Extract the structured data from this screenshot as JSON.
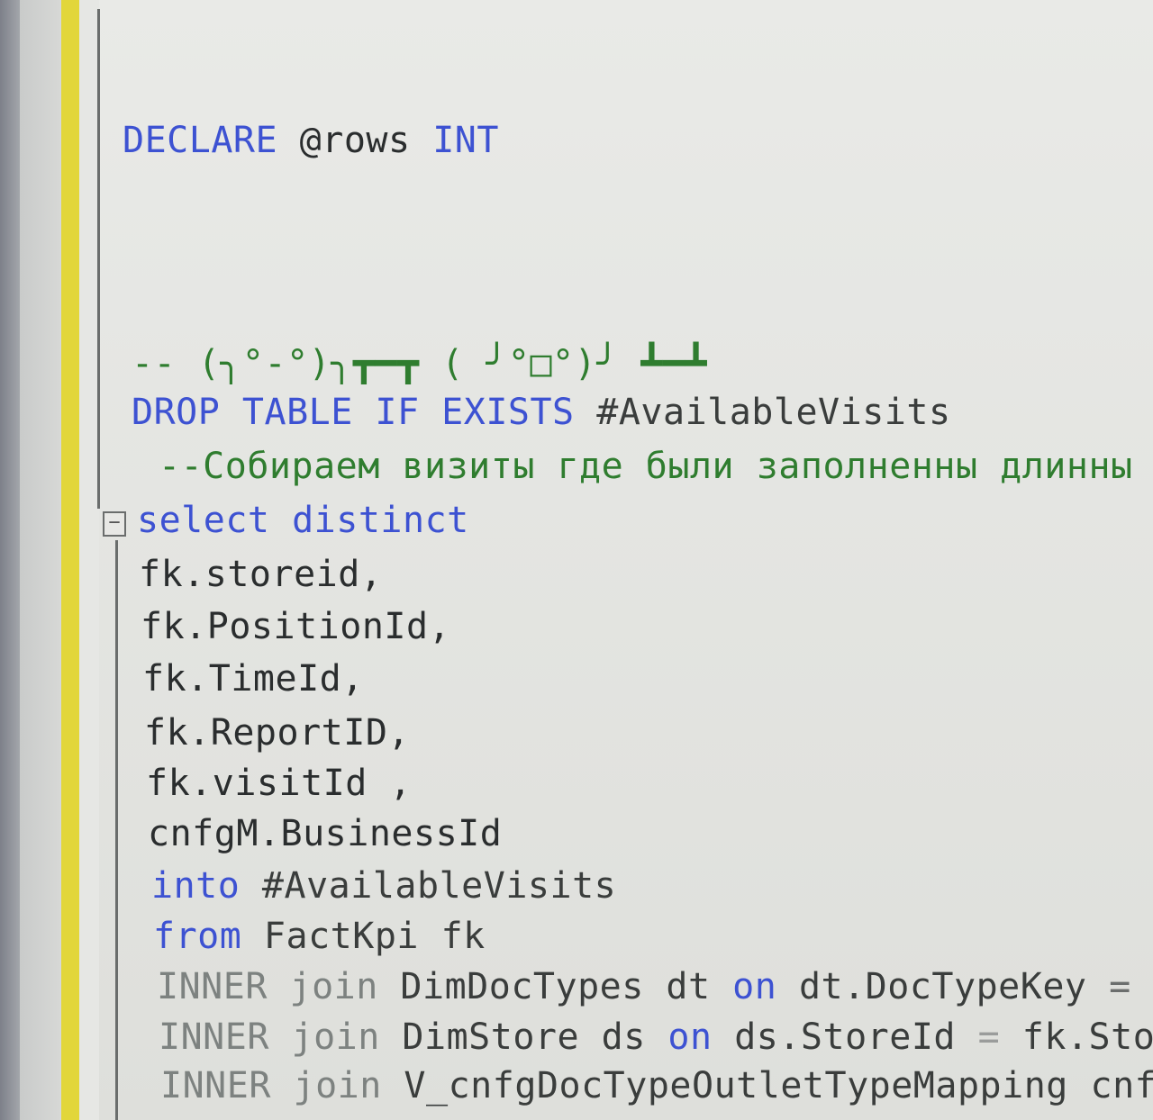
{
  "editor": {
    "lines": {
      "declare": {
        "kw1": "DECLARE",
        "var": "@rows",
        "kw2": "INT"
      },
      "comment_kaomoji": "-- (╮°-°)╮┳━┳ ( ╯°□°)╯ ┻━┻",
      "drop": {
        "kw": "DROP TABLE IF EXISTS",
        "obj": "#AvailableVisits"
      },
      "comment_ru": "--Собираем визиты где были заполненны длинны",
      "select": "select distinct",
      "cols": [
        "fk.storeid,",
        "fk.PositionId,",
        "fk.TimeId,",
        "fk.ReportID,",
        "fk.visitId ,",
        "cnfgM.BusinessId"
      ],
      "into": {
        "kw": "into",
        "obj": "#AvailableVisits"
      },
      "from": {
        "kw": "from",
        "obj": "FactKpi fk"
      },
      "join1": {
        "kw": "INNER join",
        "obj": "DimDocTypes dt",
        "on": "on",
        "cond": "dt.DocTypeKey",
        "tail": "="
      },
      "join2": {
        "kw": "INNER join",
        "obj": "DimStore ds",
        "on": "on",
        "cond": "ds.StoreId",
        "eq": "=",
        "rhs": "fk.Sto"
      },
      "join3": {
        "kw": "INNER join",
        "obj": "V_cnfgDocTypeOutletTypeMapping",
        "rhs": "cnf"
      }
    },
    "colors": {
      "keyword": "#3d52d2",
      "comment": "#2f7d2f",
      "text": "#2a2d2e",
      "change_bar": "#e2d63a"
    },
    "icons": {
      "collapse": "minus-box-icon"
    }
  }
}
